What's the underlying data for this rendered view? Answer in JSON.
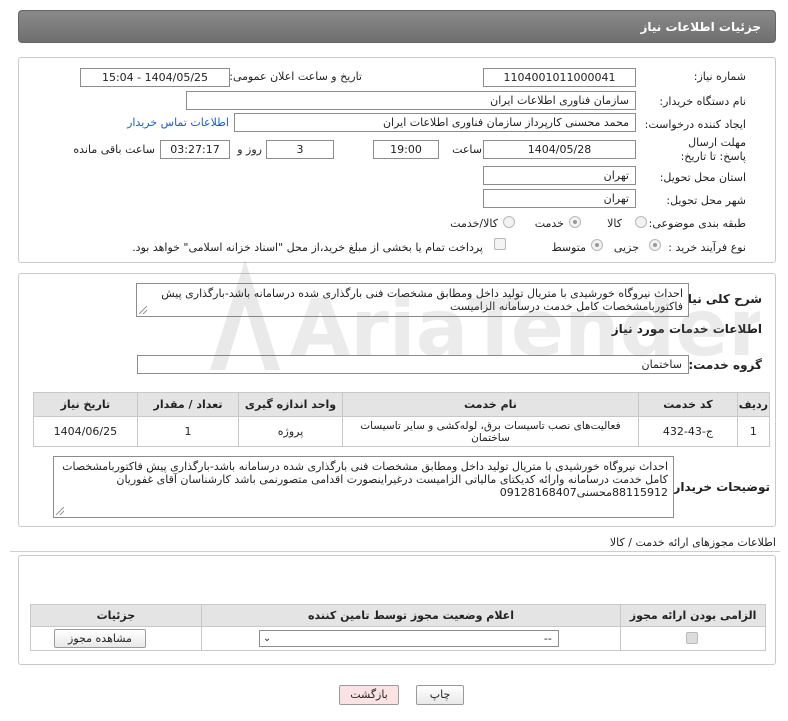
{
  "header": {
    "title": "جزئیات اطلاعات نیاز"
  },
  "form": {
    "need_number": {
      "label": "شماره نیاز:",
      "value": "1104001011000041"
    },
    "announce_datetime": {
      "label": "تاریخ و ساعت اعلان عمومی:",
      "value": "1404/05/25 - 15:04"
    },
    "buyer_org": {
      "label": "نام دستگاه خریدار:",
      "value": "سازمان فناوری اطلاعات ایران"
    },
    "requester": {
      "label": "ایجاد کننده درخواست:",
      "value": "محمد محسنی کارپرداز سازمان فناوری اطلاعات ایران",
      "contact_link": "اطلاعات تماس خریدار"
    },
    "deadline": {
      "label": "مهلت ارسال پاسخ: تا تاریخ:",
      "date": "1404/05/28",
      "time_label": "ساعت",
      "time": "19:00",
      "days": "3",
      "days_label": "روز و",
      "remaining": "03:27:17",
      "remaining_label": "ساعت باقی مانده"
    },
    "province": {
      "label": "استان محل تحویل:",
      "value": "تهران"
    },
    "city": {
      "label": "شهر محل تحویل:",
      "value": "تهران"
    },
    "category": {
      "label": "طبقه بندی موضوعی:",
      "options": [
        "کالا",
        "خدمت",
        "کالا/خدمت"
      ],
      "selected": "خدمت"
    },
    "process_type": {
      "label": "نوع فرآیند خرید :",
      "options": [
        "جزیی",
        "متوسط"
      ],
      "selected": "جزیی",
      "payment_note": "پرداخت تمام یا بخشی از مبلغ خرید،از محل \"اسناد خزانه اسلامی\" خواهد بود."
    }
  },
  "summary": {
    "label": "شرح کلی نیاز:",
    "text": "احداث نیروگاه خورشیدی با متریال تولید داخل ومطابق مشخصات فنی بارگذاری شده درسامانه باشد-بارگذاری پیش فاکتوربامشخصات کامل خدمت درسامانه الزامیست"
  },
  "services": {
    "title": "اطلاعات خدمات مورد نیاز",
    "group_label": "گروه خدمت:",
    "group_value": "ساختمان",
    "columns": [
      "ردیف",
      "کد خدمت",
      "نام خدمت",
      "واحد اندازه گیری",
      "تعداد / مقدار",
      "تاریخ نیاز"
    ],
    "rows": [
      {
        "row": "1",
        "code": "ج-43-432",
        "name": "فعالیت‌های نصب تاسیسات برق، لوله‌کشی و سایر تاسیسات ساختمان",
        "unit": "پروژه",
        "qty": "1",
        "date": "1404/06/25"
      }
    ]
  },
  "buyer_notes": {
    "label": "توضیحات خریدار:",
    "text": "احداث نیروگاه خورشیدی با متریال تولید داخل ومطابق مشخصات فنی بارگذاری شده درسامانه باشد-بارگذاری پیش فاکتوربامشخصات کامل خدمت درسامانه وارائه کدیکتای مالیاتی الزامیست درغیراینصورت اقدامی متصورنمی باشد کارشناسان آقای غفوریان 88115912محسنی09128168407"
  },
  "permits": {
    "title": "اطلاعات مجوزهای ارائه خدمت / کالا",
    "columns": [
      "الزامی بودن ارائه مجوز",
      "اعلام وضعیت مجوز توسط تامین کننده",
      "جزئیات"
    ],
    "row": {
      "select_value": "--",
      "view_button": "مشاهده مجوز"
    }
  },
  "footer": {
    "print_label": "چاپ",
    "back_label": "بازگشت"
  },
  "watermark": {
    "text": "AriaTender.neT"
  },
  "colors": {
    "header_bg": "#7a7a7a",
    "link": "#1a5ccf",
    "back_button_bg": "#fbe3e3"
  }
}
